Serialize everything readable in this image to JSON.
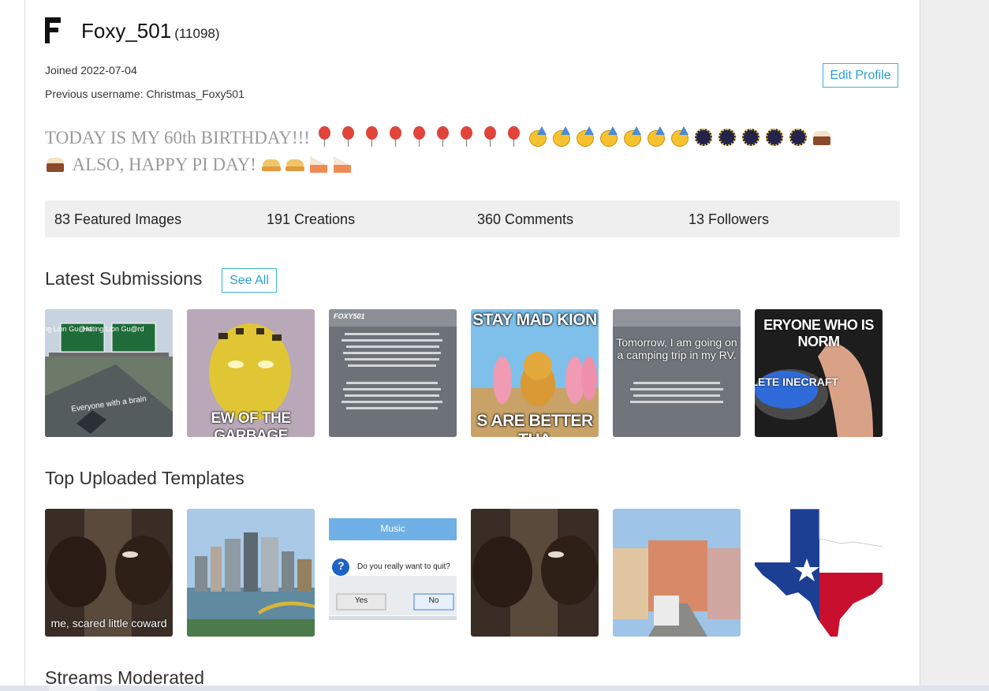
{
  "profile": {
    "avatar_letter": "F",
    "username": "Foxy_501",
    "points": "(11098)",
    "joined": "Joined 2022-07-04",
    "previous_username": "Previous username: Christmas_Foxy501",
    "edit_profile_label": "Edit Profile",
    "bio_line1": "TODAY IS MY 60th BIRTHDAY!!!",
    "bio_line2": "ALSO, HAPPY PI DAY!"
  },
  "stats": {
    "featured": "83 Featured Images",
    "creations": "191 Creations",
    "comments": "360 Comments",
    "followers": "13 Followers"
  },
  "sections": {
    "latest": "Latest Submissions",
    "see_all": "See All",
    "templates": "Top Uploaded Templates",
    "streams": "Streams Moderated"
  },
  "latest_submissions": [
    {
      "caption": "Everyone with a brain",
      "label_left": "Liking Lion Gu@rd",
      "label_right": "Hating Lion Gu@rd"
    },
    {
      "caption": "EW OF THE GARBAGE"
    },
    {
      "caption": "FOXY501"
    },
    {
      "caption_top": "STAY MAD KION",
      "caption_bottom": "S ARE BETTER THA"
    },
    {
      "caption": "Tomorrow, I am going on a camping trip in my RV."
    },
    {
      "caption_top": "ERYONE WHO IS NORM",
      "caption_button": "DELETE INECRAFT"
    }
  ],
  "top_templates": [
    {
      "caption": "me, scared little coward"
    },
    {
      "caption": ""
    },
    {
      "title": "Music",
      "question": "Do you really want to quit?",
      "yes": "Yes",
      "no": "No"
    },
    {
      "caption": ""
    },
    {
      "caption": ""
    },
    {
      "caption": ""
    }
  ]
}
